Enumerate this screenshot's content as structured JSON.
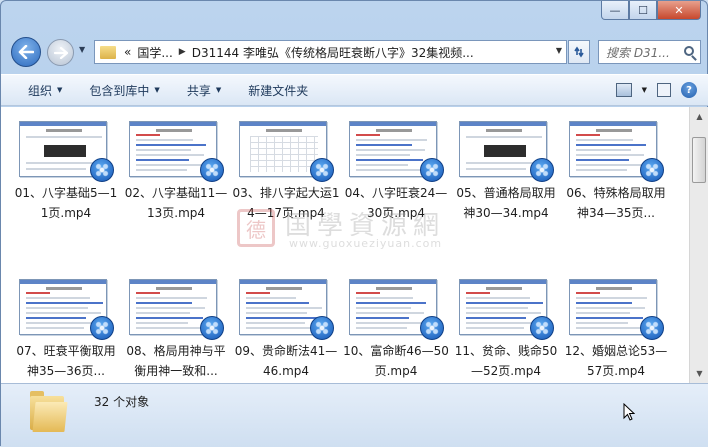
{
  "window": {
    "caption_buttons": {
      "minimize": "—",
      "maximize": "☐",
      "close": "✕"
    }
  },
  "address": {
    "prefix": "«",
    "segment1": "国学...",
    "segment2": "D31144 李唯弘《传统格局旺衰断八字》32集视频..."
  },
  "search": {
    "placeholder": "搜索 D31..."
  },
  "toolbar": {
    "organize": "组织",
    "include_in_library": "包含到库中",
    "share": "共享",
    "new_folder": "新建文件夹"
  },
  "files": [
    {
      "name": "01、八字基础5—11页.mp4"
    },
    {
      "name": "02、八字基础11—13页.mp4"
    },
    {
      "name": "03、排八字起大运14—17页.mp4"
    },
    {
      "name": "04、八字旺衰24—30页.mp4"
    },
    {
      "name": "05、普通格局取用神30—34.mp4"
    },
    {
      "name": "06、特殊格局取用神34—35页..."
    },
    {
      "name": "07、旺衰平衡取用神35—36页..."
    },
    {
      "name": "08、格局用神与平衡用神一致和..."
    },
    {
      "name": "09、贵命断法41—46.mp4"
    },
    {
      "name": "10、富命断46—50页.mp4"
    },
    {
      "name": "11、贫命、贱命50—52页.mp4"
    },
    {
      "name": "12、婚姻总论53—57页.mp4"
    }
  ],
  "watermark": {
    "seal": "德",
    "text": "国學資源網",
    "url": "www.guoxueziyuan.com"
  },
  "status": {
    "count_text": "32 个对象"
  },
  "colors": {
    "accent": "#2d6bbf",
    "window_frame": "#bcd4ee",
    "close_button": "#c7482d"
  }
}
